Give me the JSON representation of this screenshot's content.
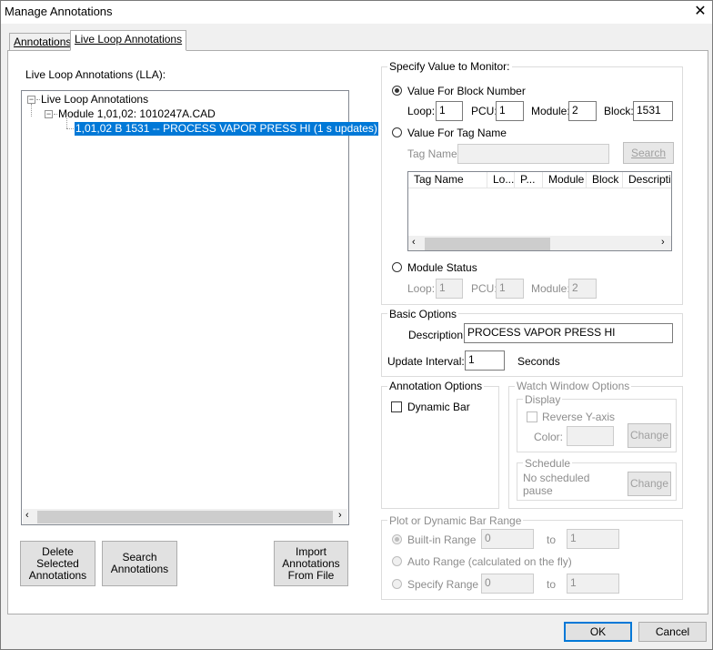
{
  "window": {
    "title": "Manage Annotations"
  },
  "tabs": [
    {
      "label": "Annotations",
      "active": false
    },
    {
      "label": "Live Loop Annotations",
      "active": true
    }
  ],
  "tree": {
    "caption": "Live Loop Annotations (LLA):",
    "root": "Live Loop Annotations",
    "module": "Module 1,01,02: 1010247A.CAD",
    "selected_item": "1,01,02 B 1531 -- PROCESS VAPOR   PRESS HI (1 s updates)"
  },
  "buttons": {
    "delete": "Delete Selected Annotations",
    "search": "Search Annotations",
    "import": "Import Annotations From File",
    "ok": "OK",
    "cancel": "Cancel"
  },
  "specify": {
    "legend": "Specify Value to Monitor:",
    "block_option": "Value For Block Number",
    "block_fields": {
      "loop_label": "Loop:",
      "loop_value": "1",
      "pcu_label": "PCU:",
      "pcu_value": "1",
      "module_label": "Module:",
      "module_value": "2",
      "block_label": "Block:",
      "block_value": "1531"
    },
    "tag_option": "Value For Tag Name",
    "tag_name_label": "Tag Name:",
    "tag_name_value": "",
    "search_button": "Search",
    "tag_columns": [
      "Tag Name",
      "Lo...",
      "P...",
      "Module",
      "Block",
      "Description"
    ],
    "module_status_option": "Module Status",
    "status_fields": {
      "loop_label": "Loop:",
      "loop_value": "1",
      "pcu_label": "PCU:",
      "pcu_value": "1",
      "module_label": "Module:",
      "module_value": "2"
    }
  },
  "basic": {
    "legend": "Basic Options",
    "description_label": "Description:",
    "description_value": "PROCESS VAPOR   PRESS HI",
    "interval_label": "Update Interval:",
    "interval_value": "1",
    "interval_unit": "Seconds"
  },
  "annotation_options": {
    "legend": "Annotation Options",
    "dynamic_bar": "Dynamic Bar"
  },
  "watch": {
    "legend": "Watch Window Options",
    "display_legend": "Display",
    "reverse_y": "Reverse Y-axis",
    "color_label": "Color:",
    "change_label": "Change",
    "schedule_legend": "Schedule",
    "schedule_text": "No scheduled pause",
    "schedule_change": "Change"
  },
  "range": {
    "legend": "Plot or Dynamic Bar Range",
    "builtin": "Built-in Range",
    "builtin_from": "0",
    "builtin_to": "1",
    "auto": "Auto Range (calculated on the fly)",
    "specify": "Specify Range",
    "specify_from": "0",
    "specify_to": "1",
    "to_label": "to"
  }
}
